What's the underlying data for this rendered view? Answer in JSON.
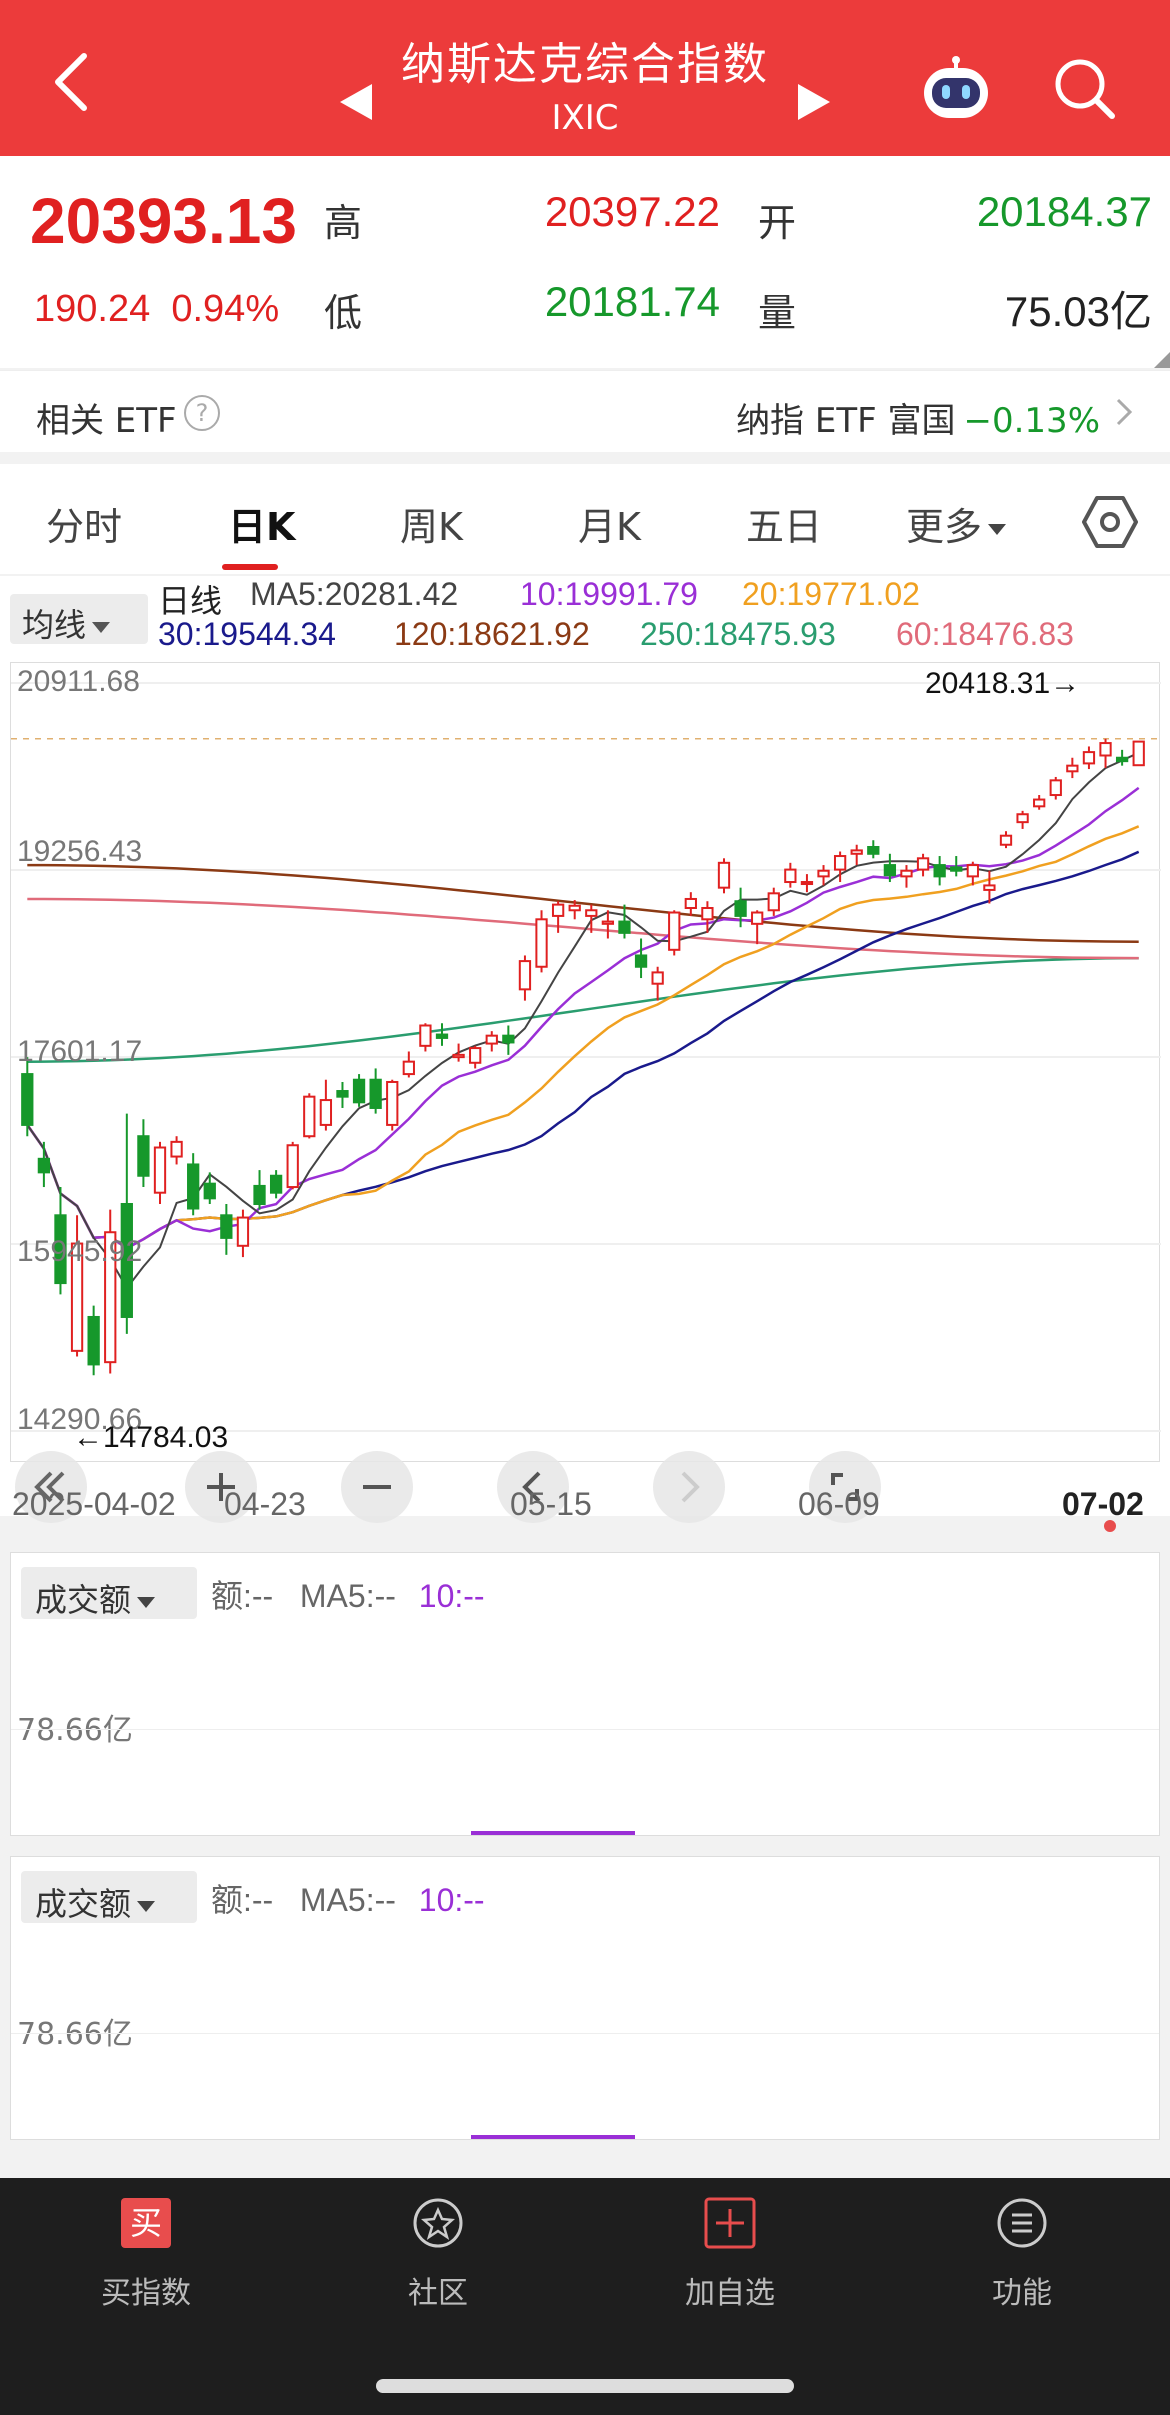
{
  "header": {
    "title": "纳斯达克综合指数",
    "code": "IXIC",
    "icons": [
      "back-icon",
      "prev-index-icon",
      "next-index-icon",
      "robot-assistant-icon",
      "search-icon"
    ]
  },
  "quote": {
    "price": "20393.13",
    "change": "190.24",
    "change_pct": "0.94%",
    "high_label": "高",
    "high": "20397.22",
    "open_label": "开",
    "open": "20184.37",
    "low_label": "低",
    "low": "20181.74",
    "vol_label": "量",
    "volume": "75.03亿",
    "colors": {
      "up": "#e02020",
      "down": "#16982b"
    }
  },
  "etf": {
    "label": "相关 ETF",
    "help_icon": "?",
    "name": "纳指 ETF 富国",
    "pct": "−0.13%"
  },
  "tabs": {
    "items": [
      "分时",
      "日K",
      "周K",
      "月K",
      "五日",
      "更多"
    ],
    "active": "日K"
  },
  "ma": {
    "button": "均线",
    "period_label": "日线",
    "ma5": "MA5:20281.42",
    "ma10": "10:19991.79",
    "ma20": "20:19771.02",
    "ma30": "30:19544.34",
    "ma120": "120:18621.92",
    "ma250": "250:18475.93",
    "ma60": "60:18476.83",
    "colors": {
      "ma5": "#444444",
      "ma10": "#9a2fd6",
      "ma20": "#f0a020",
      "ma30": "#1a1a8c",
      "ma60": "#e06b7a",
      "ma120": "#8b3a14",
      "ma250": "#2a9d6f"
    }
  },
  "chart": {
    "price_labels": [
      "20911.68",
      "19256.43",
      "17601.17",
      "15945.92",
      "14290.66"
    ],
    "high_marker": "20418.31→",
    "low_marker": "←14784.03",
    "dates": [
      "2025-04-02",
      "04-23",
      "05-15",
      "06-09",
      "07-02"
    ],
    "controls": [
      "collapse-left-icon",
      "zoom-in-icon",
      "zoom-out-icon",
      "pan-left-icon",
      "pan-right-icon",
      "fullscreen-icon"
    ]
  },
  "chart_data": {
    "type": "candlestick",
    "title": "",
    "ylim": [
      14290.66,
      20911.68
    ],
    "x_start": "2025-04-02",
    "x_end": "2025-07-02",
    "candles_ohlc": [
      [
        17450,
        17600,
        16900,
        17000
      ],
      [
        16700,
        16850,
        16450,
        16580
      ],
      [
        16200,
        16450,
        15500,
        15600
      ],
      [
        15000,
        16200,
        14950,
        15950
      ],
      [
        15300,
        15400,
        14784,
        14880
      ],
      [
        14900,
        16250,
        14800,
        16050
      ],
      [
        16300,
        17100,
        15150,
        15300
      ],
      [
        16900,
        17050,
        16450,
        16550
      ],
      [
        16400,
        16850,
        16300,
        16800
      ],
      [
        16720,
        16900,
        16650,
        16850
      ],
      [
        16650,
        16750,
        16200,
        16260
      ],
      [
        16480,
        16580,
        16300,
        16350
      ],
      [
        16200,
        16300,
        15850,
        16000
      ],
      [
        15930,
        16250,
        15830,
        16180
      ],
      [
        16460,
        16600,
        16250,
        16300
      ],
      [
        16550,
        16600,
        16350,
        16400
      ],
      [
        16450,
        16850,
        16430,
        16820
      ],
      [
        16900,
        17280,
        16880,
        17250
      ],
      [
        17000,
        17400,
        16950,
        17220
      ],
      [
        17300,
        17380,
        17150,
        17250
      ],
      [
        17400,
        17450,
        17160,
        17200
      ],
      [
        17400,
        17500,
        17100,
        17150
      ],
      [
        17000,
        17400,
        16950,
        17380
      ],
      [
        17450,
        17650,
        17420,
        17560
      ],
      [
        17700,
        17900,
        17650,
        17880
      ],
      [
        17800,
        17900,
        17700,
        17770
      ],
      [
        17600,
        17720,
        17560,
        17620
      ],
      [
        17550,
        17700,
        17500,
        17680
      ],
      [
        17720,
        17830,
        17650,
        17790
      ],
      [
        17790,
        17880,
        17620,
        17730
      ],
      [
        18200,
        18500,
        18100,
        18450
      ],
      [
        18400,
        18900,
        18350,
        18820
      ],
      [
        18850,
        18980,
        18700,
        18950
      ],
      [
        18900,
        18990,
        18820,
        18940
      ],
      [
        18850,
        18950,
        18700,
        18900
      ],
      [
        18780,
        18900,
        18650,
        18800
      ],
      [
        18800,
        18950,
        18650,
        18700
      ],
      [
        18500,
        18650,
        18300,
        18400
      ],
      [
        18250,
        18400,
        18100,
        18350
      ],
      [
        18550,
        18900,
        18500,
        18880
      ],
      [
        18920,
        19060,
        18850,
        19000
      ],
      [
        18820,
        18980,
        18700,
        18920
      ],
      [
        19100,
        19360,
        19050,
        19320
      ],
      [
        18980,
        19100,
        18750,
        18850
      ],
      [
        18780,
        18900,
        18600,
        18880
      ],
      [
        18900,
        19100,
        18850,
        19050
      ],
      [
        19150,
        19320,
        19100,
        19260
      ],
      [
        19150,
        19220,
        19060,
        19150
      ],
      [
        19200,
        19300,
        19120,
        19250
      ],
      [
        19260,
        19420,
        19150,
        19380
      ],
      [
        19400,
        19480,
        19300,
        19430
      ],
      [
        19460,
        19520,
        19360,
        19400
      ],
      [
        19300,
        19400,
        19150,
        19210
      ],
      [
        19200,
        19300,
        19100,
        19250
      ],
      [
        19260,
        19400,
        19200,
        19360
      ],
      [
        19300,
        19380,
        19120,
        19200
      ],
      [
        19280,
        19380,
        19200,
        19250
      ],
      [
        19200,
        19330,
        19120,
        19300
      ],
      [
        19080,
        19250,
        18960,
        19120
      ],
      [
        19480,
        19600,
        19450,
        19560
      ],
      [
        19680,
        19780,
        19620,
        19750
      ],
      [
        19820,
        19920,
        19790,
        19880
      ],
      [
        19920,
        20080,
        19880,
        20050
      ],
      [
        20130,
        20250,
        20070,
        20180
      ],
      [
        20200,
        20350,
        20150,
        20300
      ],
      [
        20270,
        20418,
        20160,
        20380
      ],
      [
        20250,
        20320,
        20180,
        20220
      ],
      [
        20184,
        20397,
        20181,
        20393
      ]
    ],
    "ma_reference": {
      "MA5": 20281.42,
      "MA10": 19991.79,
      "MA20": 19771.02,
      "MA30": 19544.34,
      "MA60": 18476.83,
      "MA120": 18621.92,
      "MA250": 18475.93
    }
  },
  "volume": {
    "panes": [
      {
        "button": "成交额",
        "info_amount": "额:--",
        "info_ma5": "MA5:--",
        "info_ma10": "10:--",
        "scale": "78.66亿"
      },
      {
        "button": "成交额",
        "info_amount": "额:--",
        "info_ma5": "MA5:--",
        "info_ma10": "10:--",
        "scale": "78.66亿"
      }
    ]
  },
  "bottom_nav": {
    "items": [
      {
        "label": "买指数",
        "icon": "buy-icon",
        "glyph": "买"
      },
      {
        "label": "社区",
        "icon": "community-icon"
      },
      {
        "label": "加自选",
        "icon": "add-watchlist-icon"
      },
      {
        "label": "功能",
        "icon": "menu-icon"
      }
    ]
  }
}
